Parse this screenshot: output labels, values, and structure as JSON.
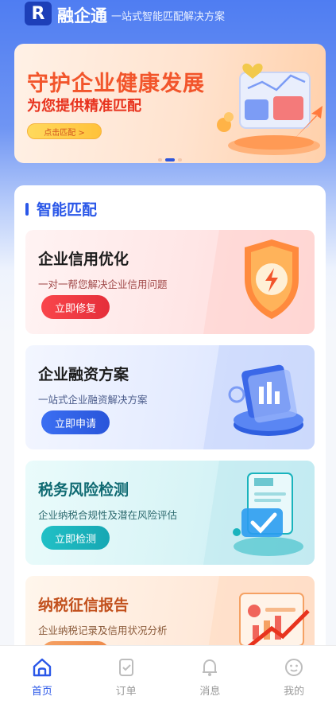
{
  "header": {
    "logo_letter": "R",
    "app_name": "融企通",
    "subtitle": "一站式智能匹配解决方案"
  },
  "banner": {
    "title": "守护企业健康发展",
    "subtitle": "为您提供精准匹配",
    "button_label": "点击匹配 >",
    "carousel_pages": 3,
    "active_page": 2
  },
  "section": {
    "title": "智能匹配"
  },
  "cards": [
    {
      "title": "企业信用优化",
      "description": "一对一帮您解决企业信用问题",
      "button_label": "立即修复",
      "icon": "shield-lightning-icon"
    },
    {
      "title": "企业融资方案",
      "description": "一站式企业融资解决方案",
      "button_label": "立即申请",
      "icon": "finance-chart-icon"
    },
    {
      "title": "税务风险检测",
      "description": "企业纳税合规性及潜在风险评估",
      "button_label": "立即检测",
      "icon": "document-check-icon"
    },
    {
      "title": "纳税征信报告",
      "description": "企业纳税记录及信用状况分析",
      "button_label": "",
      "icon": "report-chart-icon"
    }
  ],
  "tabbar": {
    "items": [
      {
        "label": "首页",
        "icon": "home-icon",
        "active": true
      },
      {
        "label": "订单",
        "icon": "order-icon",
        "active": false
      },
      {
        "label": "消息",
        "icon": "bell-icon",
        "active": false
      },
      {
        "label": "我的",
        "icon": "profile-icon",
        "active": false
      }
    ]
  },
  "colors": {
    "primary": "#2a57e8",
    "banner_title": "#f2552b",
    "credit_button": "#e52e3a",
    "finance_button": "#2955da",
    "tax_button": "#16a7b3",
    "report_button": "#ee8a4a"
  }
}
